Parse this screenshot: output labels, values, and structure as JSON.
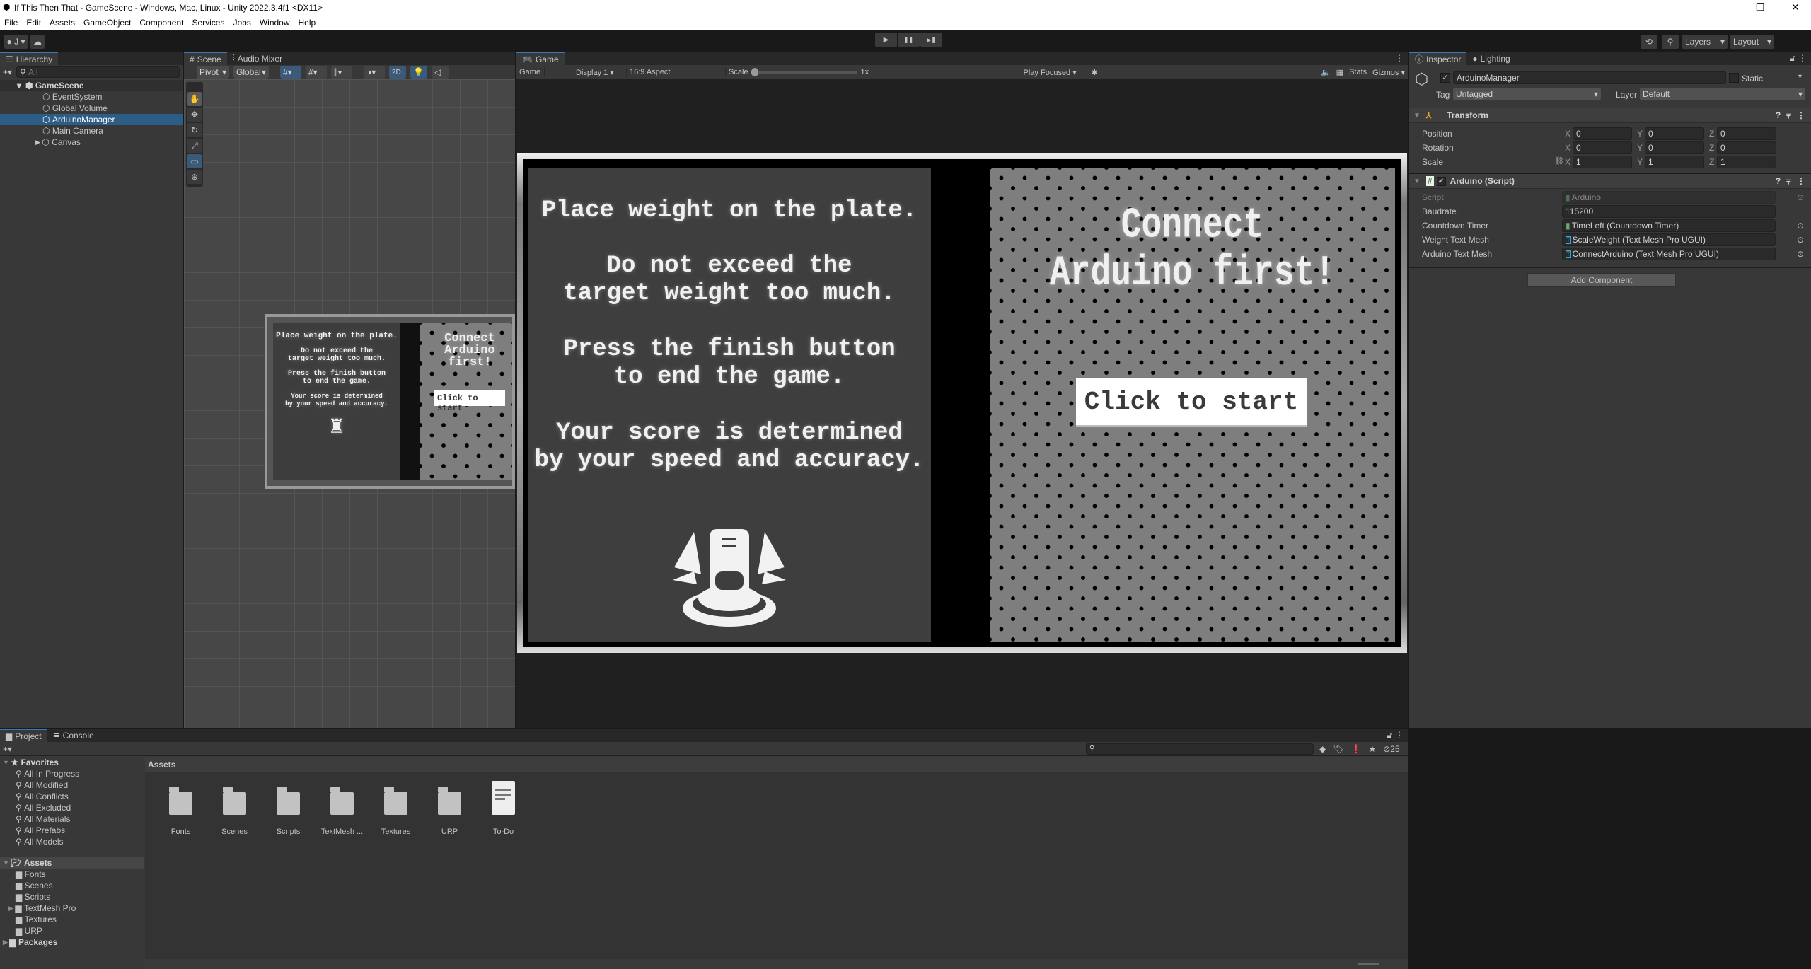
{
  "window": {
    "title": "If This Then That - GameScene - Windows, Mac, Linux - Unity 2022.3.4f1 <DX11>",
    "controls": {
      "minimize": "—",
      "maximize": "❐",
      "close": "✕"
    }
  },
  "menu": [
    "File",
    "Edit",
    "Assets",
    "GameObject",
    "Component",
    "Services",
    "Jobs",
    "Window",
    "Help"
  ],
  "toolbar": {
    "account": "J",
    "play": "▶",
    "pause": "❚❚",
    "step": "▶❚",
    "layers": "Layers",
    "layout": "Layout"
  },
  "hierarchy": {
    "tab": "Hierarchy",
    "search_placeholder": "All",
    "scene": "GameScene",
    "items": [
      "EventSystem",
      "Global Volume",
      "ArduinoManager",
      "Main Camera",
      "Canvas"
    ],
    "selected": "ArduinoManager"
  },
  "scene": {
    "tabs": [
      "Scene",
      "Audio Mixer"
    ],
    "pivot": "Pivot",
    "global": "Global",
    "mode_2d": "2D"
  },
  "game": {
    "tab": "Game",
    "view": "Game",
    "display": "Display 1",
    "aspect": "16:9 Aspect",
    "scale_label": "Scale",
    "scale_value": "1x",
    "play_focused": "Play Focused",
    "stats": "Stats",
    "gizmos": "Gizmos",
    "instructions": [
      "Place weight on the plate.",
      "Do not exceed the\ntarget weight too much.",
      "Press the finish button\nto end the game.",
      "Your score is determined\nby your speed and accuracy."
    ],
    "connect": "Connect\nArduino first!",
    "start_button": "Click to start"
  },
  "inspector": {
    "tabs": [
      "Inspector",
      "Lighting"
    ],
    "object_name": "ArduinoManager",
    "static": "Static",
    "tag_label": "Tag",
    "tag": "Untagged",
    "layer_label": "Layer",
    "layer": "Default",
    "transform": {
      "title": "Transform",
      "rows": [
        {
          "label": "Position",
          "x": "0",
          "y": "0",
          "z": "0"
        },
        {
          "label": "Rotation",
          "x": "0",
          "y": "0",
          "z": "0"
        },
        {
          "label": "Scale",
          "x": "1",
          "y": "1",
          "z": "1"
        }
      ]
    },
    "script": {
      "title": "Arduino (Script)",
      "rows": [
        {
          "label": "Script",
          "value": "Arduino"
        },
        {
          "label": "Baudrate",
          "value": "115200"
        },
        {
          "label": "Countdown Timer",
          "value": "TimeLeft (Countdown Timer)"
        },
        {
          "label": "Weight Text Mesh",
          "value": "ScaleWeight (Text Mesh Pro UGUI)"
        },
        {
          "label": "Arduino Text Mesh",
          "value": "ConnectArduino (Text Mesh Pro UGUI)"
        }
      ]
    },
    "add_component": "Add Component"
  },
  "project": {
    "tabs": [
      "Project",
      "Console"
    ],
    "hidden_count": "25",
    "favorites_label": "Favorites",
    "favorites": [
      "All In Progress",
      "All Modified",
      "All Conflicts",
      "All Excluded",
      "All Materials",
      "All Prefabs",
      "All Models"
    ],
    "assets_label": "Assets",
    "asset_folders": [
      "Fonts",
      "Scenes",
      "Scripts",
      "TextMesh Pro",
      "Textures",
      "URP"
    ],
    "packages_label": "Packages",
    "breadcrumb": "Assets",
    "grid": [
      "Fonts",
      "Scenes",
      "Scripts",
      "TextMesh ...",
      "Textures",
      "URP",
      "To-Do"
    ]
  }
}
